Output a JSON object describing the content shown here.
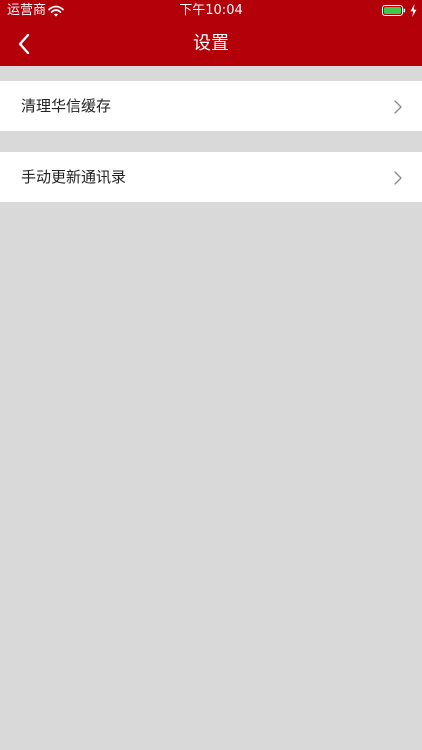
{
  "status_bar": {
    "carrier": "运营商",
    "time": "下午10:04",
    "wifi_icon": "wifi-icon",
    "battery_icon": "battery-icon",
    "charging_icon": "charging-bolt-icon"
  },
  "nav": {
    "title": "设置",
    "back_icon": "chevron-left-icon"
  },
  "settings": {
    "items": [
      {
        "label": "清理华信缓存",
        "icon": "chevron-right-icon"
      },
      {
        "label": "手动更新通讯录",
        "icon": "chevron-right-icon"
      }
    ]
  },
  "colors": {
    "header": "#b30009",
    "page_background": "#d9d9d9",
    "row_background": "#ffffff",
    "battery_fill": "#3dc94a"
  }
}
